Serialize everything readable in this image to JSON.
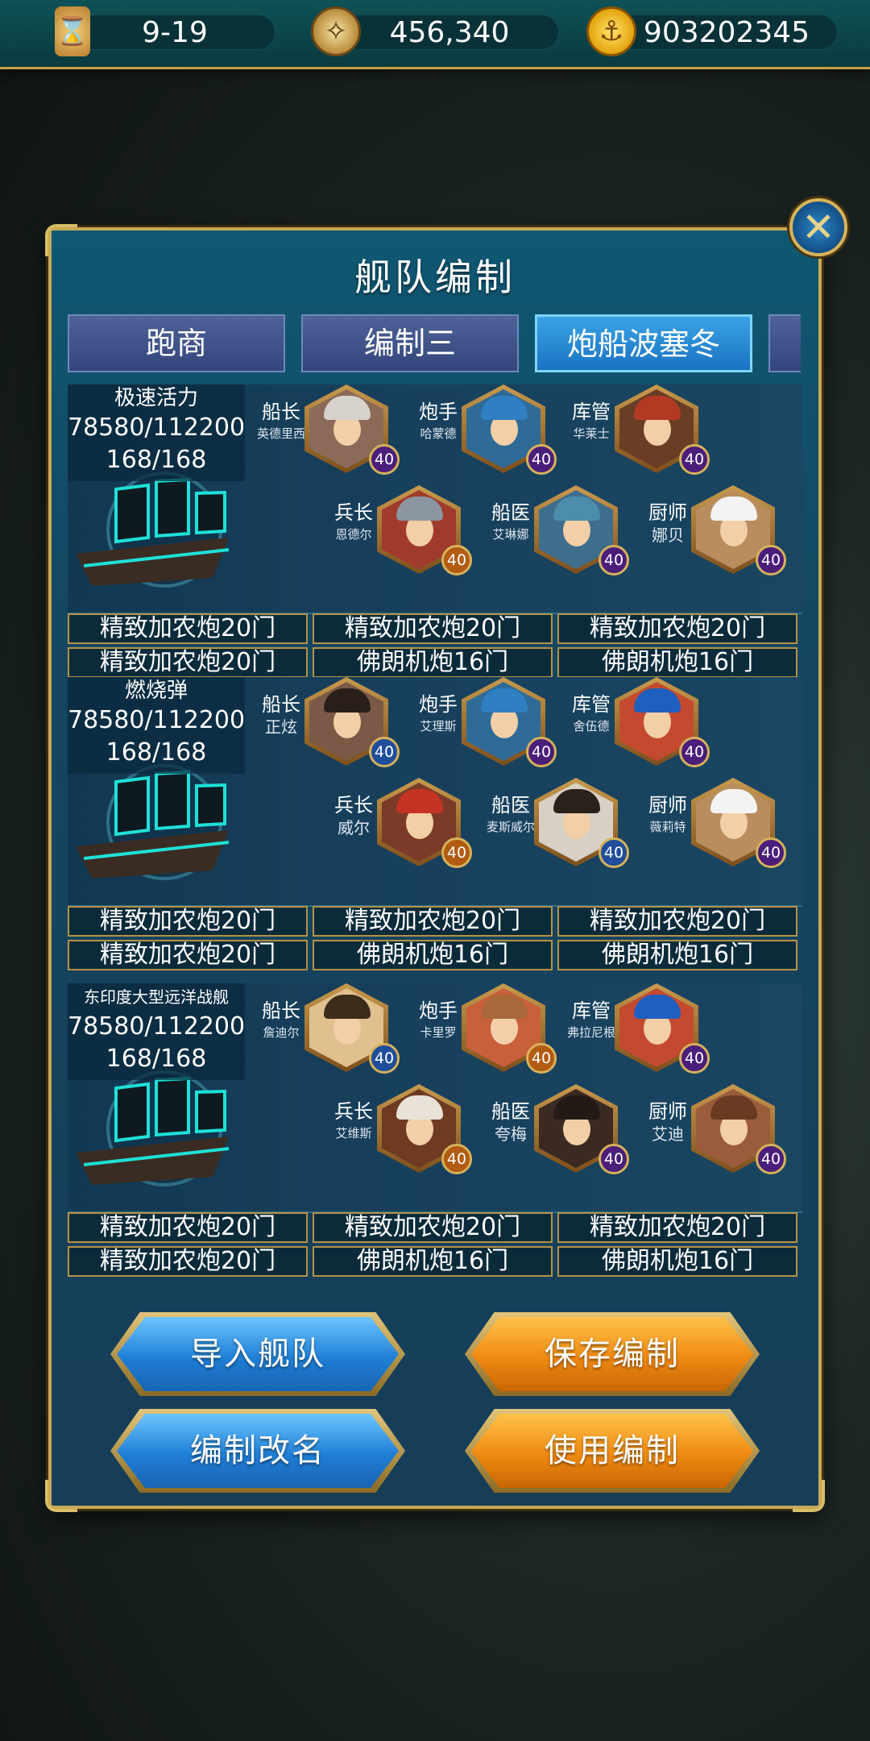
{
  "topbar": {
    "date": "9-19",
    "compass_value": "456,340",
    "gold": "903202345"
  },
  "dialog": {
    "title": "舰队编制",
    "tabs": [
      "跑商",
      "编制三",
      "炮船波塞冬"
    ],
    "active_tab": 2
  },
  "fleets": [
    {
      "ship_name": "极速活力",
      "durability": "78580/112200",
      "sailors": "168/168",
      "crew": [
        {
          "role": "船长",
          "name": "英德里西",
          "level": "40"
        },
        {
          "role": "炮手",
          "name": "哈蒙德",
          "level": "40"
        },
        {
          "role": "库管",
          "name": "华莱士",
          "level": "40"
        },
        {
          "role": "兵长",
          "name": "恩德尔",
          "level": "40"
        },
        {
          "role": "船医",
          "name": "艾琳娜",
          "level": "40"
        },
        {
          "role": "厨师",
          "name": "娜贝",
          "level": "40"
        }
      ],
      "cannons": [
        "精致加农炮20门",
        "精致加农炮20门",
        "精致加农炮20门",
        "精致加农炮20门",
        "佛朗机炮16门",
        "佛朗机炮16门"
      ]
    },
    {
      "ship_name": "燃烧弹",
      "durability": "78580/112200",
      "sailors": "168/168",
      "crew": [
        {
          "role": "船长",
          "name": "正炫",
          "level": "40"
        },
        {
          "role": "炮手",
          "name": "艾理斯",
          "level": "40"
        },
        {
          "role": "库管",
          "name": "舍伍德",
          "level": "40"
        },
        {
          "role": "兵长",
          "name": "威尔",
          "level": "40"
        },
        {
          "role": "船医",
          "name": "麦斯威尔",
          "level": "40"
        },
        {
          "role": "厨师",
          "name": "薇莉特",
          "level": "40"
        }
      ],
      "cannons": [
        "精致加农炮20门",
        "精致加农炮20门",
        "精致加农炮20门",
        "精致加农炮20门",
        "佛朗机炮16门",
        "佛朗机炮16门"
      ]
    },
    {
      "ship_name": "东印度大型远洋战舰",
      "durability": "78580/112200",
      "sailors": "168/168",
      "crew": [
        {
          "role": "船长",
          "name": "詹迪尔",
          "level": "40"
        },
        {
          "role": "炮手",
          "name": "卡里罗",
          "level": "40"
        },
        {
          "role": "库管",
          "name": "弗拉尼根",
          "level": "40"
        },
        {
          "role": "兵长",
          "name": "艾维斯",
          "level": "40"
        },
        {
          "role": "船医",
          "name": "夸梅",
          "level": "40"
        },
        {
          "role": "厨师",
          "name": "艾迪",
          "level": "40"
        }
      ],
      "cannons": [
        "精致加农炮20门",
        "精致加农炮20门",
        "精致加农炮20门",
        "精致加农炮20门",
        "佛朗机炮16门",
        "佛朗机炮16门"
      ]
    }
  ],
  "buttons": {
    "import_fleet": "导入舰队",
    "save_formation": "保存编制",
    "rename_formation": "编制改名",
    "use_formation": "使用编制"
  },
  "colors": {
    "panel": "#144762",
    "gold_border": "#c8a857",
    "tab_active": "#1a73c2",
    "button_blue": "#1f7fd6",
    "button_orange": "#f08a12"
  }
}
